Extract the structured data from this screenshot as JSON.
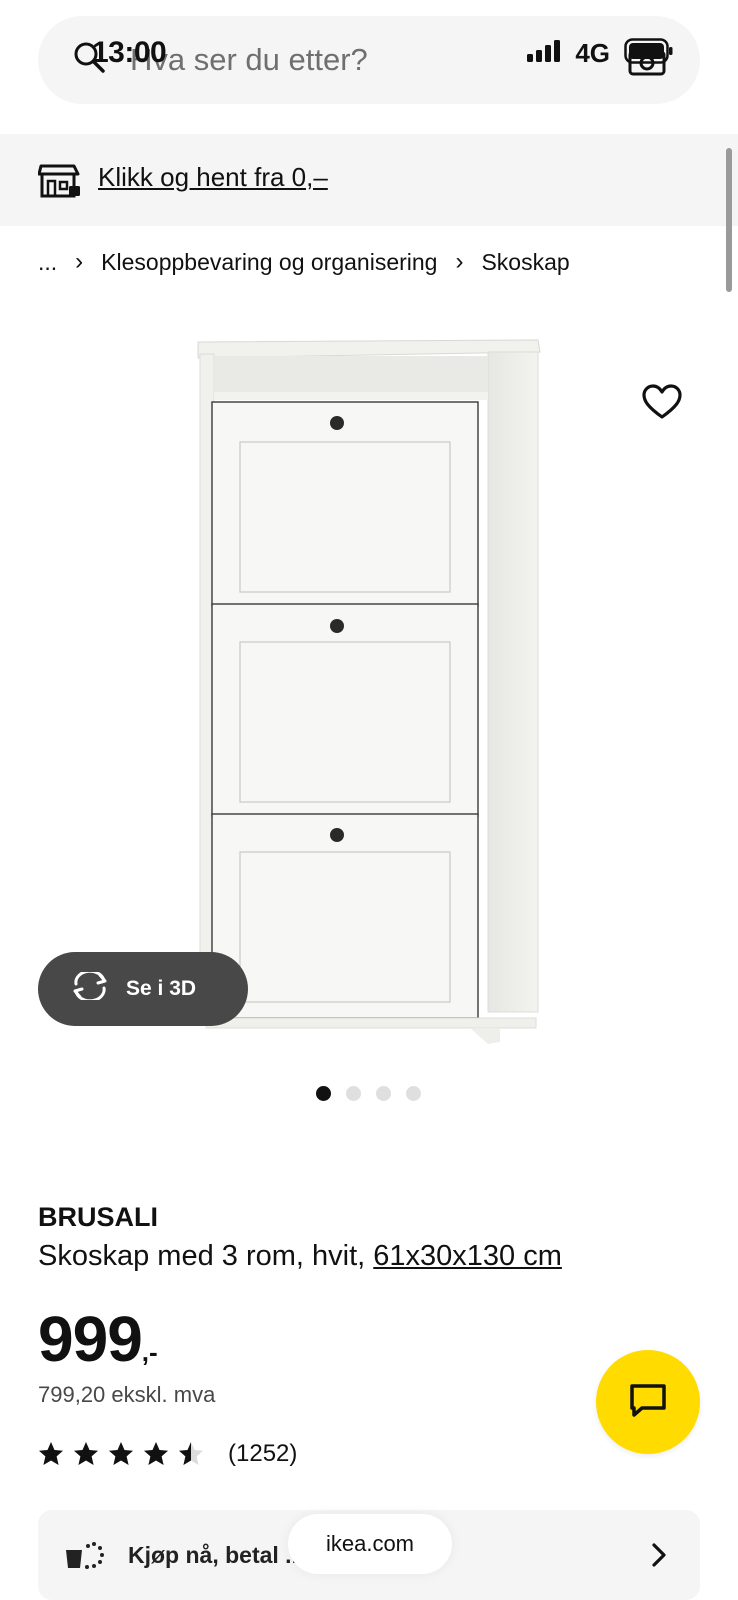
{
  "status": {
    "time": "13:00",
    "network": "4G"
  },
  "search": {
    "placeholder": "Hva ser du etter?"
  },
  "store_banner": {
    "label": "Klikk og hent fra 0,–"
  },
  "breadcrumb": {
    "ellipsis": "...",
    "items": [
      "Klesoppbevaring og organisering",
      "Skoskap"
    ]
  },
  "media": {
    "see_3d_label": "Se i 3D",
    "image_count": 4,
    "active_index": 0
  },
  "product": {
    "name": "BRUSALI",
    "description": "Skoskap med 3 rom, hvit, ",
    "dimensions": "61x30x130 cm",
    "price": "999",
    "price_suffix": ",-",
    "price_excl": "799,20 ekskl. mva",
    "rating": {
      "value": 4.5,
      "max": 5,
      "count": "(1252)"
    }
  },
  "pay_row": {
    "label": "Kjøp nå, betal ..."
  },
  "browser": {
    "url": "ikea.com"
  },
  "colors": {
    "accent_yellow": "#ffdb00",
    "dark_button": "#484848",
    "panel_grey": "#f5f5f5"
  },
  "icons": [
    "search-icon",
    "camera-icon",
    "store-icon",
    "heart-icon",
    "rotate-3d-icon",
    "chat-icon",
    "star-icon",
    "pay-later-icon",
    "chevron-right-icon",
    "signal-icon",
    "battery-icon"
  ]
}
